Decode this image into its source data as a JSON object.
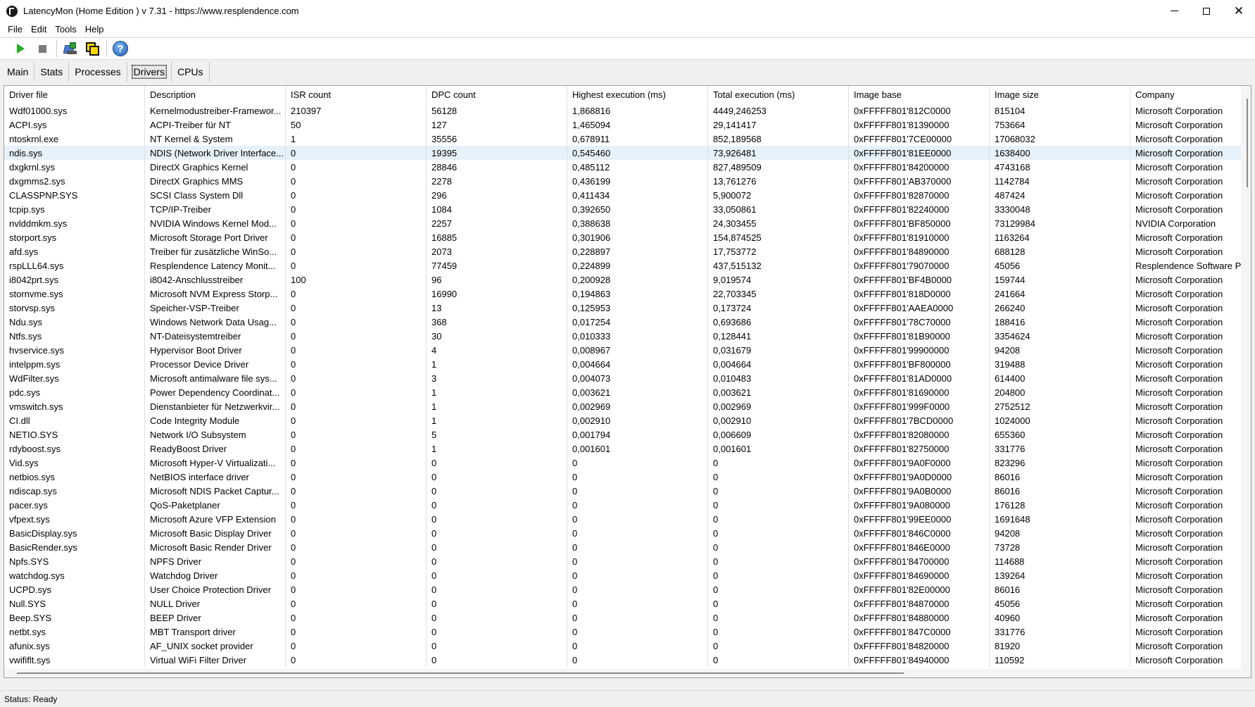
{
  "window": {
    "title": "LatencyMon  (Home Edition )  v 7.31 - https://www.resplendence.com",
    "min_glyph": "",
    "max_glyph": "",
    "close_glyph": "✕"
  },
  "menu": [
    "File",
    "Edit",
    "Tools",
    "Help"
  ],
  "toolbar": {
    "buttons": [
      {
        "icon": "play-icon"
      },
      {
        "icon": "stop-icon"
      },
      {
        "icon": "drivers-tool-icon"
      },
      {
        "icon": "cpu-tool-icon"
      },
      {
        "icon": "help-icon",
        "glyph": "?"
      }
    ]
  },
  "tabs": {
    "items": [
      "Main",
      "Stats",
      "Processes",
      "Drivers",
      "CPUs"
    ],
    "active": "Drivers"
  },
  "grid": {
    "columns": [
      "Driver file",
      "Description",
      "ISR count",
      "DPC count",
      "Highest execution (ms)",
      "Total execution (ms)",
      "Image base",
      "Image size",
      "Company"
    ],
    "selected_row": 3,
    "rows": [
      [
        "Wdf01000.sys",
        "Kernelmodustreiber-Framewor...",
        "210397",
        "56128",
        "1,868816",
        "4449,246253",
        "0xFFFFF801'812C0000",
        "815104",
        "Microsoft Corporation"
      ],
      [
        "ACPI.sys",
        "ACPI-Treiber für NT",
        "50",
        "127",
        "1,465094",
        "29,141417",
        "0xFFFFF801'81390000",
        "753664",
        "Microsoft Corporation"
      ],
      [
        "ntoskrnl.exe",
        "NT Kernel & System",
        "1",
        "35556",
        "0,678911",
        "852,189568",
        "0xFFFFF801'7CE00000",
        "17068032",
        "Microsoft Corporation"
      ],
      [
        "ndis.sys",
        "NDIS (Network Driver Interface...",
        "0",
        "19395",
        "0,545460",
        "73,926481",
        "0xFFFFF801'81EE0000",
        "1638400",
        "Microsoft Corporation"
      ],
      [
        "dxgkrnl.sys",
        "DirectX Graphics Kernel",
        "0",
        "28846",
        "0,485112",
        "827,489509",
        "0xFFFFF801'84200000",
        "4743168",
        "Microsoft Corporation"
      ],
      [
        "dxgmms2.sys",
        "DirectX Graphics MMS",
        "0",
        "2278",
        "0,436199",
        "13,761276",
        "0xFFFFF801'AB370000",
        "1142784",
        "Microsoft Corporation"
      ],
      [
        "CLASSPNP.SYS",
        "SCSI Class System Dll",
        "0",
        "296",
        "0,411434",
        "5,900072",
        "0xFFFFF801'82870000",
        "487424",
        "Microsoft Corporation"
      ],
      [
        "tcpip.sys",
        "TCP/IP-Treiber",
        "0",
        "1084",
        "0,392650",
        "33,050861",
        "0xFFFFF801'82240000",
        "3330048",
        "Microsoft Corporation"
      ],
      [
        "nvlddmkm.sys",
        "NVIDIA Windows Kernel Mod...",
        "0",
        "2257",
        "0,388638",
        "24,303455",
        "0xFFFFF801'BF850000",
        "73129984",
        "NVIDIA Corporation"
      ],
      [
        "storport.sys",
        "Microsoft Storage Port Driver",
        "0",
        "16885",
        "0,301906",
        "154,874525",
        "0xFFFFF801'81910000",
        "1163264",
        "Microsoft Corporation"
      ],
      [
        "afd.sys",
        "Treiber für zusätzliche WinSo...",
        "0",
        "2073",
        "0,228897",
        "17,753772",
        "0xFFFFF801'84890000",
        "688128",
        "Microsoft Corporation"
      ],
      [
        "rspLLL64.sys",
        "Resplendence Latency Monit...",
        "0",
        "77459",
        "0,224899",
        "437,515132",
        "0xFFFFF801'79070000",
        "45056",
        "Resplendence Software P"
      ],
      [
        "i8042prt.sys",
        "i8042-Anschlusstreiber",
        "100",
        "96",
        "0,200928",
        "9,019574",
        "0xFFFFF801'BF4B0000",
        "159744",
        "Microsoft Corporation"
      ],
      [
        "stornvme.sys",
        "Microsoft NVM Express Storp...",
        "0",
        "16990",
        "0,194863",
        "22,703345",
        "0xFFFFF801'818D0000",
        "241664",
        "Microsoft Corporation"
      ],
      [
        "storvsp.sys",
        "Speicher-VSP-Treiber",
        "0",
        "13",
        "0,125953",
        "0,173724",
        "0xFFFFF801'AAEA0000",
        "266240",
        "Microsoft Corporation"
      ],
      [
        "Ndu.sys",
        "Windows Network Data Usag...",
        "0",
        "368",
        "0,017254",
        "0,693686",
        "0xFFFFF801'78C70000",
        "188416",
        "Microsoft Corporation"
      ],
      [
        "Ntfs.sys",
        "NT-Dateisystemtreiber",
        "0",
        "30",
        "0,010333",
        "0,128441",
        "0xFFFFF801'81B90000",
        "3354624",
        "Microsoft Corporation"
      ],
      [
        "hvservice.sys",
        "Hypervisor Boot Driver",
        "0",
        "4",
        "0,008967",
        "0,031679",
        "0xFFFFF801'99900000",
        "94208",
        "Microsoft Corporation"
      ],
      [
        "intelppm.sys",
        "Processor Device Driver",
        "0",
        "1",
        "0,004664",
        "0,004664",
        "0xFFFFF801'BF800000",
        "319488",
        "Microsoft Corporation"
      ],
      [
        "WdFilter.sys",
        "Microsoft antimalware file sys...",
        "0",
        "3",
        "0,004073",
        "0,010483",
        "0xFFFFF801'81AD0000",
        "614400",
        "Microsoft Corporation"
      ],
      [
        "pdc.sys",
        "Power Dependency Coordinat...",
        "0",
        "1",
        "0,003621",
        "0,003621",
        "0xFFFFF801'81690000",
        "204800",
        "Microsoft Corporation"
      ],
      [
        "vmswitch.sys",
        "Dienstanbieter für Netzwerkvir...",
        "0",
        "1",
        "0,002969",
        "0,002969",
        "0xFFFFF801'999F0000",
        "2752512",
        "Microsoft Corporation"
      ],
      [
        "CI.dll",
        "Code Integrity Module",
        "0",
        "1",
        "0,002910",
        "0,002910",
        "0xFFFFF801'7BCD0000",
        "1024000",
        "Microsoft Corporation"
      ],
      [
        "NETIO.SYS",
        "Network I/O Subsystem",
        "0",
        "5",
        "0,001794",
        "0,006609",
        "0xFFFFF801'82080000",
        "655360",
        "Microsoft Corporation"
      ],
      [
        "rdyboost.sys",
        "ReadyBoost Driver",
        "0",
        "1",
        "0,001601",
        "0,001601",
        "0xFFFFF801'82750000",
        "331776",
        "Microsoft Corporation"
      ],
      [
        "Vid.sys",
        "Microsoft Hyper-V Virtualizati...",
        "0",
        "0",
        "0",
        "0",
        "0xFFFFF801'9A0F0000",
        "823296",
        "Microsoft Corporation"
      ],
      [
        "netbios.sys",
        "NetBIOS interface driver",
        "0",
        "0",
        "0",
        "0",
        "0xFFFFF801'9A0D0000",
        "86016",
        "Microsoft Corporation"
      ],
      [
        "ndiscap.sys",
        "Microsoft NDIS Packet Captur...",
        "0",
        "0",
        "0",
        "0",
        "0xFFFFF801'9A0B0000",
        "86016",
        "Microsoft Corporation"
      ],
      [
        "pacer.sys",
        "QoS-Paketplaner",
        "0",
        "0",
        "0",
        "0",
        "0xFFFFF801'9A080000",
        "176128",
        "Microsoft Corporation"
      ],
      [
        "vfpext.sys",
        "Microsoft Azure VFP Extension",
        "0",
        "0",
        "0",
        "0",
        "0xFFFFF801'99EE0000",
        "1691648",
        "Microsoft Corporation"
      ],
      [
        "BasicDisplay.sys",
        "Microsoft Basic Display Driver",
        "0",
        "0",
        "0",
        "0",
        "0xFFFFF801'846C0000",
        "94208",
        "Microsoft Corporation"
      ],
      [
        "BasicRender.sys",
        "Microsoft Basic Render Driver",
        "0",
        "0",
        "0",
        "0",
        "0xFFFFF801'846E0000",
        "73728",
        "Microsoft Corporation"
      ],
      [
        "Npfs.SYS",
        "NPFS Driver",
        "0",
        "0",
        "0",
        "0",
        "0xFFFFF801'84700000",
        "114688",
        "Microsoft Corporation"
      ],
      [
        "watchdog.sys",
        "Watchdog Driver",
        "0",
        "0",
        "0",
        "0",
        "0xFFFFF801'84690000",
        "139264",
        "Microsoft Corporation"
      ],
      [
        "UCPD.sys",
        "User Choice Protection Driver",
        "0",
        "0",
        "0",
        "0",
        "0xFFFFF801'82E00000",
        "86016",
        "Microsoft Corporation"
      ],
      [
        "Null.SYS",
        "NULL Driver",
        "0",
        "0",
        "0",
        "0",
        "0xFFFFF801'84870000",
        "45056",
        "Microsoft Corporation"
      ],
      [
        "Beep.SYS",
        "BEEP Driver",
        "0",
        "0",
        "0",
        "0",
        "0xFFFFF801'84880000",
        "40960",
        "Microsoft Corporation"
      ],
      [
        "netbt.sys",
        "MBT Transport driver",
        "0",
        "0",
        "0",
        "0",
        "0xFFFFF801'847C0000",
        "331776",
        "Microsoft Corporation"
      ],
      [
        "afunix.sys",
        "AF_UNIX socket provider",
        "0",
        "0",
        "0",
        "0",
        "0xFFFFF801'84820000",
        "81920",
        "Microsoft Corporation"
      ],
      [
        "vwififlt.sys",
        "Virtual WiFi Filter Driver",
        "0",
        "0",
        "0",
        "0",
        "0xFFFFF801'84940000",
        "110592",
        "Microsoft Corporation"
      ]
    ]
  },
  "status": "Status: Ready"
}
